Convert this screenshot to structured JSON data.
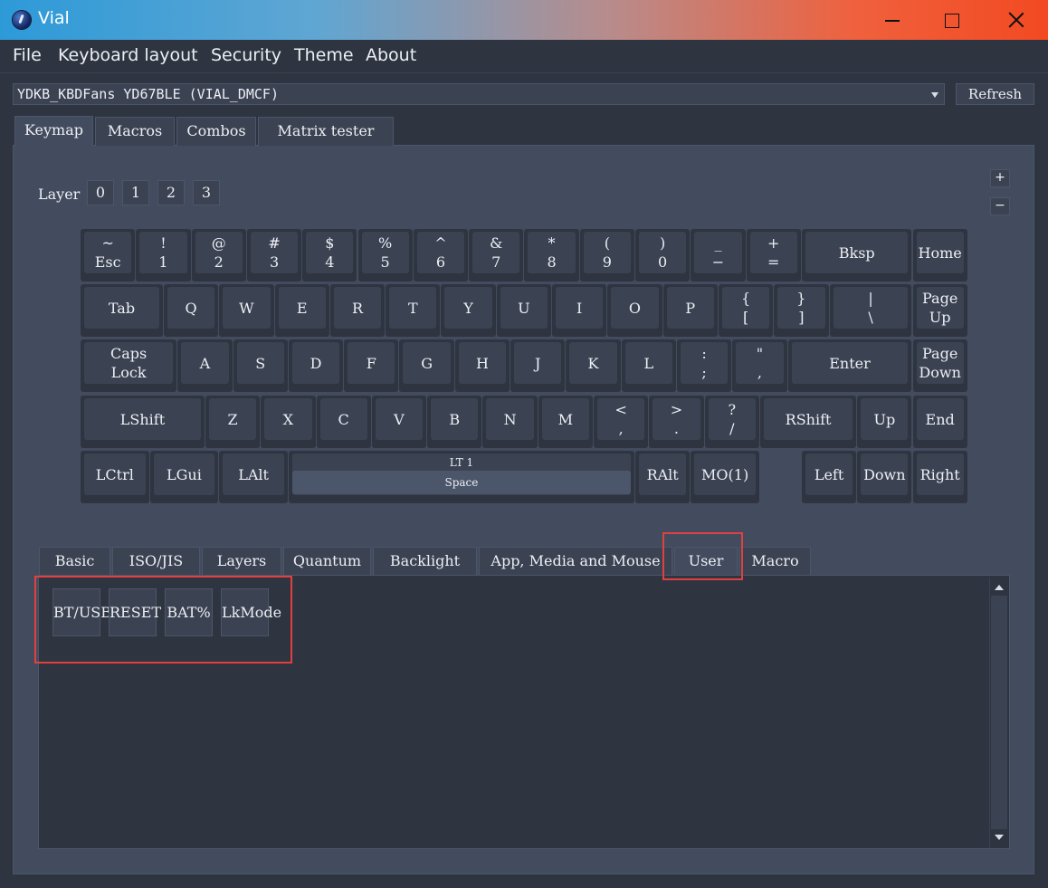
{
  "window": {
    "title": "Vial",
    "icon": "vial-logo-icon"
  },
  "menubar": [
    "File",
    "Keyboard layout",
    "Security",
    "Theme",
    "About"
  ],
  "device": {
    "selected": "YDKB_KBDFans YD67BLE (VIAL_DMCF)",
    "refresh_label": "Refresh"
  },
  "main_tabs": [
    "Keymap",
    "Macros",
    "Combos",
    "Matrix tester"
  ],
  "active_main_tab": "Keymap",
  "layers": {
    "label": "Layer",
    "buttons": [
      "0",
      "1",
      "2",
      "3"
    ]
  },
  "zoom": {
    "plus": "+",
    "minus": "−"
  },
  "keys": [
    "~\nEsc",
    "!\n1",
    "@\n2",
    "#\n3",
    "$\n4",
    "%\n5",
    "^\n6",
    "&\n7",
    "*\n8",
    "(\n9",
    ")\n0",
    "_\n−",
    "+\n=",
    "Bksp",
    "Home",
    "Tab",
    "Q",
    "W",
    "E",
    "R",
    "T",
    "Y",
    "U",
    "I",
    "O",
    "P",
    "{\n[",
    "}\n]",
    "|\n\\",
    "Page\nUp",
    "Caps\nLock",
    "A",
    "S",
    "D",
    "F",
    "G",
    "H",
    "J",
    "K",
    "L",
    ":\n;",
    "\"\n,",
    "Enter",
    "Page\nDown",
    "LShift",
    "Z",
    "X",
    "C",
    "V",
    "B",
    "N",
    "M",
    "<\n,",
    ">\n.",
    "?\n/",
    "RShift",
    "Up",
    "End",
    "LCtrl",
    "LGui",
    "LAlt",
    "",
    "RAlt",
    "MO(1)",
    "Left",
    "Down",
    "Right"
  ],
  "space_key": {
    "top": "LT 1",
    "bottom": "Space"
  },
  "keycode_tabs": [
    "Basic",
    "ISO/JIS",
    "Layers",
    "Quantum",
    "Backlight",
    "App, Media and Mouse",
    "User",
    "Macro"
  ],
  "active_keycode_tab": "User",
  "user_keycodes": [
    "BT/USB",
    "RESET",
    "BAT%",
    "LkMode"
  ],
  "colors": {
    "highlight": "#e04040",
    "background": "#2e3440",
    "panel": "#434c5e"
  }
}
